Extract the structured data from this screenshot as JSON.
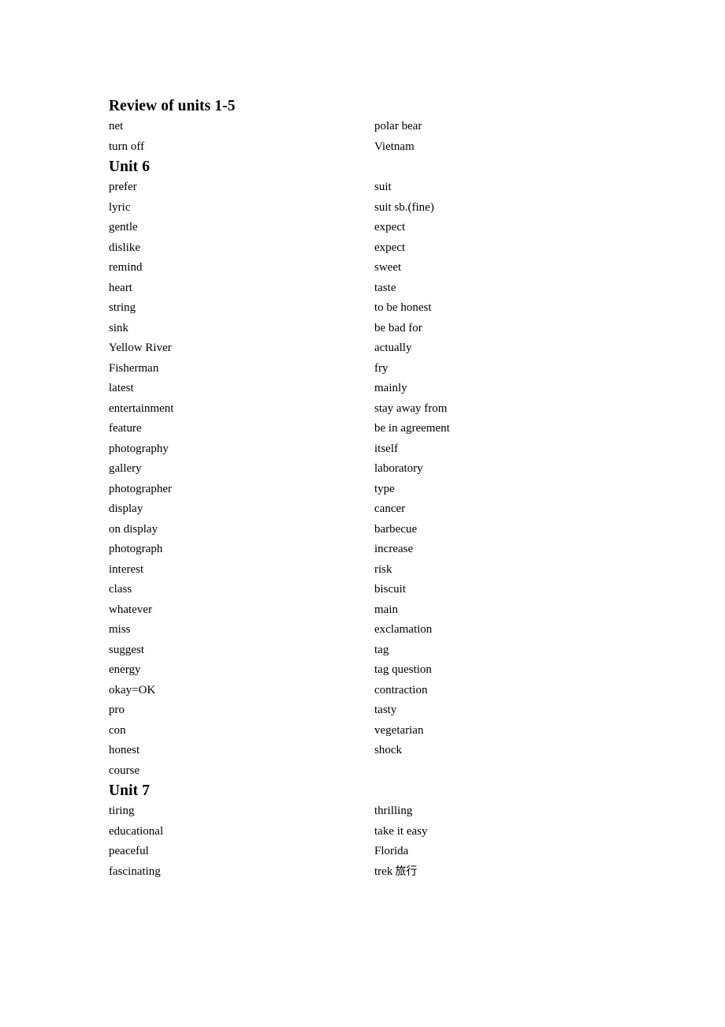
{
  "document": {
    "background_color": "#ffffff",
    "text_color": "#000000"
  },
  "sections": [
    {
      "heading": "Review of units 1-5",
      "rows": [
        {
          "left": "net",
          "right": "polar bear"
        },
        {
          "left": "turn off",
          "right": "Vietnam"
        }
      ]
    },
    {
      "heading": "Unit 6",
      "rows": [
        {
          "left": "prefer",
          "right": "suit"
        },
        {
          "left": "lyric",
          "right": "suit sb.(fine)"
        },
        {
          "left": "gentle",
          "right": "expect"
        },
        {
          "left": "dislike",
          "right": "expect"
        },
        {
          "left": "remind",
          "right": "sweet"
        },
        {
          "left": "heart",
          "right": "taste"
        },
        {
          "left": "string",
          "right": "to be honest"
        },
        {
          "left": "sink",
          "right": "be bad for"
        },
        {
          "left": "Yellow River",
          "right": "actually"
        },
        {
          "left": "Fisherman",
          "right": "fry"
        },
        {
          "left": "latest",
          "right": "mainly"
        },
        {
          "left": "entertainment",
          "right": "stay away from"
        },
        {
          "left": "feature",
          "right": "be in agreement"
        },
        {
          "left": "photography",
          "right": "itself"
        },
        {
          "left": "gallery",
          "right": "laboratory"
        },
        {
          "left": "photographer",
          "right": "type"
        },
        {
          "left": "display",
          "right": "cancer"
        },
        {
          "left": "on display",
          "right": "barbecue"
        },
        {
          "left": "photograph",
          "right": "increase"
        },
        {
          "left": "interest",
          "right": "risk"
        },
        {
          "left": "class",
          "right": "biscuit"
        },
        {
          "left": "whatever",
          "right": "main"
        },
        {
          "left": "miss",
          "right": "exclamation"
        },
        {
          "left": "suggest",
          "right": "tag"
        },
        {
          "left": "energy",
          "right": "tag question"
        },
        {
          "left": "okay=OK",
          "right": "contraction"
        },
        {
          "left": "pro",
          "right": "tasty"
        },
        {
          "left": "con",
          "right": "vegetarian"
        },
        {
          "left": "honest",
          "right": "shock"
        },
        {
          "left": "course",
          "right": ""
        }
      ]
    },
    {
      "heading": "Unit 7",
      "rows": [
        {
          "left": "tiring",
          "right": "thrilling"
        },
        {
          "left": "educational",
          "right": "take it easy"
        },
        {
          "left": "peaceful",
          "right": "Florida"
        },
        {
          "left": "fascinating",
          "right": "trek",
          "right_cjk": "旅行"
        }
      ]
    }
  ]
}
